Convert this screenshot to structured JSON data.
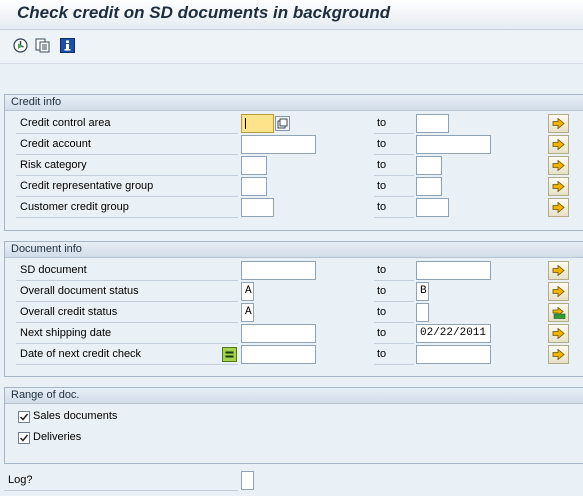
{
  "window": {
    "title": "Check credit on SD documents in background"
  },
  "toolbar": {
    "buttons": [
      {
        "icon": "execute-icon"
      },
      {
        "icon": "get-variant-icon"
      },
      {
        "icon": "info-icon"
      }
    ]
  },
  "credit_info": {
    "title": "Credit info",
    "to_label": "to",
    "rows": [
      {
        "label": "Credit control area",
        "from": "",
        "to": ""
      },
      {
        "label": "Credit account",
        "from": "",
        "to": ""
      },
      {
        "label": "Risk category",
        "from": "",
        "to": ""
      },
      {
        "label": "Credit representative group",
        "from": "",
        "to": ""
      },
      {
        "label": "Customer credit group",
        "from": "",
        "to": ""
      }
    ]
  },
  "document_info": {
    "title": "Document info",
    "to_label": "to",
    "rows": [
      {
        "label": "SD document",
        "from": "",
        "to": ""
      },
      {
        "label": "Overall document status",
        "from": "A",
        "to": "B"
      },
      {
        "label": "Overall credit status",
        "from": "A",
        "to": ""
      },
      {
        "label": "Next shipping date",
        "from": "",
        "to": "02/22/2011"
      },
      {
        "label": "Date of next credit check",
        "from": "",
        "to": ""
      }
    ]
  },
  "range_of_doc": {
    "title": "Range of doc.",
    "sales_documents": {
      "label": "Sales documents",
      "checked": true
    },
    "deliveries": {
      "label": "Deliveries",
      "checked": true
    }
  },
  "log": {
    "label": "Log?",
    "checked": false
  },
  "colors": {
    "focused_field": "#ffe38a",
    "active_selection": "#2e9b3a",
    "arrow": "#e8a300"
  }
}
